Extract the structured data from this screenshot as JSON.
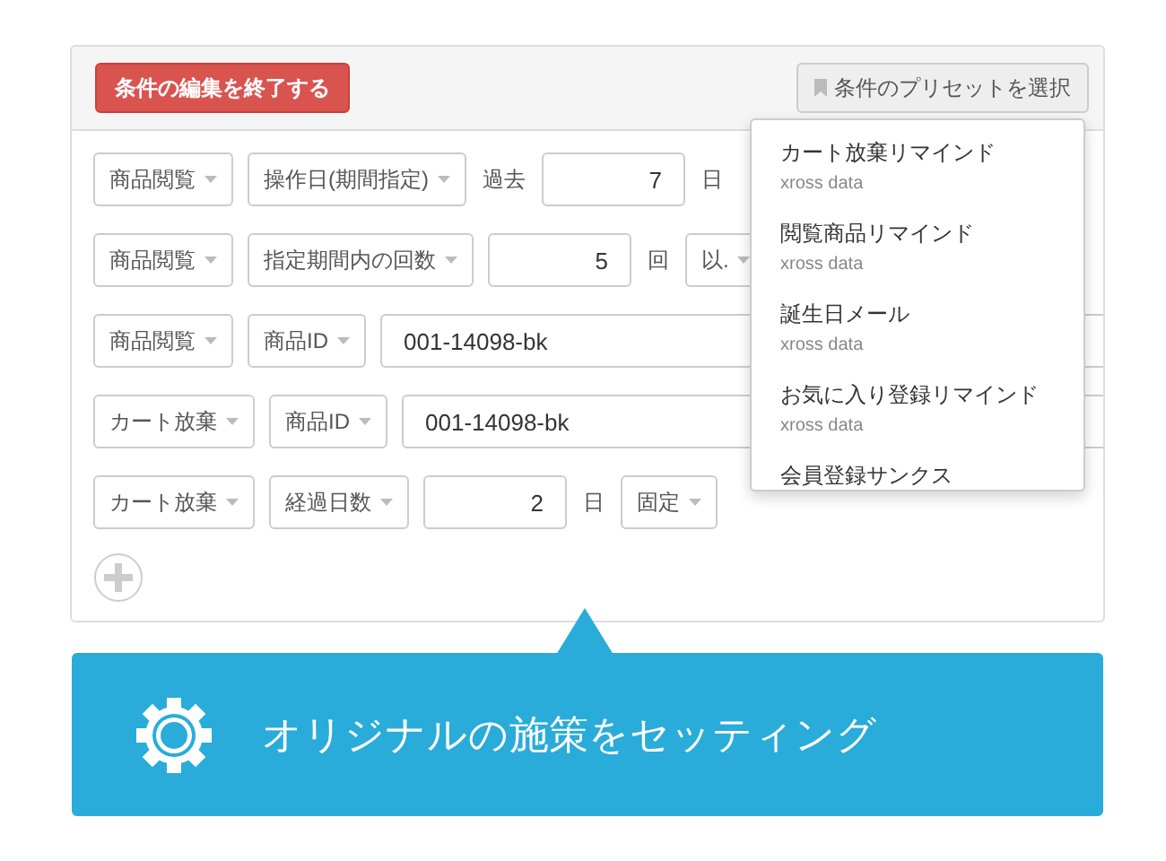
{
  "header": {
    "finish_button": "条件の編集を終了する",
    "preset_button": "条件のプリセットを選択"
  },
  "rows": [
    {
      "items": [
        {
          "kind": "dropdown",
          "label": "商品閲覧"
        },
        {
          "kind": "dropdown",
          "label": "操作日(期間指定)"
        },
        {
          "kind": "text",
          "label": "過去"
        },
        {
          "kind": "number",
          "value": "7"
        },
        {
          "kind": "text",
          "label": "日"
        }
      ]
    },
    {
      "items": [
        {
          "kind": "dropdown",
          "label": "商品閲覧"
        },
        {
          "kind": "dropdown",
          "label": "指定期間内の回数"
        },
        {
          "kind": "number",
          "value": "5"
        },
        {
          "kind": "text",
          "label": "回"
        },
        {
          "kind": "dropdown",
          "label": "以."
        }
      ]
    },
    {
      "items": [
        {
          "kind": "dropdown",
          "label": "商品閲覧"
        },
        {
          "kind": "dropdown",
          "label": "商品ID"
        },
        {
          "kind": "textinput",
          "value": "001-14098-bk"
        }
      ]
    },
    {
      "items": [
        {
          "kind": "dropdown",
          "label": "カート放棄"
        },
        {
          "kind": "dropdown",
          "label": "商品ID"
        },
        {
          "kind": "textinput",
          "value": "001-14098-bk"
        }
      ]
    },
    {
      "items": [
        {
          "kind": "dropdown",
          "label": "カート放棄"
        },
        {
          "kind": "dropdown",
          "label": "経過日数"
        },
        {
          "kind": "number",
          "value": "2"
        },
        {
          "kind": "text",
          "label": "日"
        },
        {
          "kind": "dropdown",
          "label": "固定"
        }
      ]
    }
  ],
  "preset_menu": [
    {
      "title": "カート放棄リマインド",
      "source": "xross data"
    },
    {
      "title": "閲覧商品リマインド",
      "source": "xross data"
    },
    {
      "title": "誕生日メール",
      "source": "xross data"
    },
    {
      "title": "お気に入り登録リマインド",
      "source": "xross data"
    },
    {
      "title": "会員登録サンクス"
    }
  ],
  "callout": {
    "text": "オリジナルの施策をセッティング"
  }
}
